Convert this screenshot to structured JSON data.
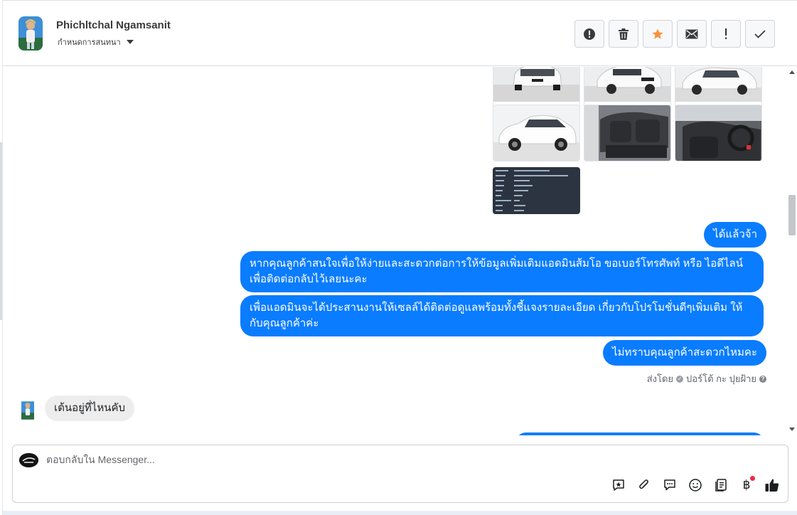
{
  "header": {
    "contact_name": "Phichltchal Ngamsanit",
    "assign_label": "กำหนดการสนทนา",
    "actions": [
      {
        "name": "report-spam-button",
        "icon": "alert-circle-icon"
      },
      {
        "name": "delete-button",
        "icon": "trash-icon"
      },
      {
        "name": "star-button",
        "icon": "star-icon"
      },
      {
        "name": "mark-unread-button",
        "icon": "envelope-icon"
      },
      {
        "name": "follow-up-button",
        "icon": "exclamation-icon"
      },
      {
        "name": "mark-done-button",
        "icon": "check-icon"
      }
    ]
  },
  "colors": {
    "outgoing_bubble": "#0a7cff",
    "incoming_bubble": "#ededed",
    "star": "#f7923b",
    "notification_dot": "#f02849"
  },
  "messages": [
    {
      "direction": "outgoing",
      "text": "ได้แล้วจ้า"
    },
    {
      "direction": "outgoing",
      "text": "หากคุณลูกค้าสนใจเพื่อให้ง่ายและสะดวกต่อการให้ข้อมูลเพิ่มเติมแอดมินส้มโอ ขอเบอร์โทรศัพท์ หรือ ไอดีไลน์ เพื่อติดต่อกลับไว้เลยนะคะ"
    },
    {
      "direction": "outgoing",
      "text": "เพื่อแอดมินจะได้ประสานงานให้เซลล์ได้ติดต่อดูแลพร้อมทั้งชี้แจงรายละเอียด เกี่ยวกับโปรโมชั่นดีๆเพิ่มเติม ให้กับคุณลูกค้าค่ะ"
    },
    {
      "direction": "outgoing",
      "text": "ไม่ทราบคุณลูกค้าสะดวกไหมคะ"
    },
    {
      "direction": "incoming",
      "text": "เต้นอยู่ที่ไหนคับ"
    }
  ],
  "sent_by": {
    "prefix": "ส่งโดย",
    "agent": "ปอร์โต้ กะ ปุยฝ้าย"
  },
  "composer": {
    "placeholder": "ตอบกลับใน Messenger...",
    "baht_symbol": "฿",
    "tools": [
      "saved-reply-icon",
      "attachment-icon",
      "chat-bubble-icon",
      "emoji-icon",
      "catalog-icon",
      "payment-icon",
      "like-icon"
    ]
  }
}
